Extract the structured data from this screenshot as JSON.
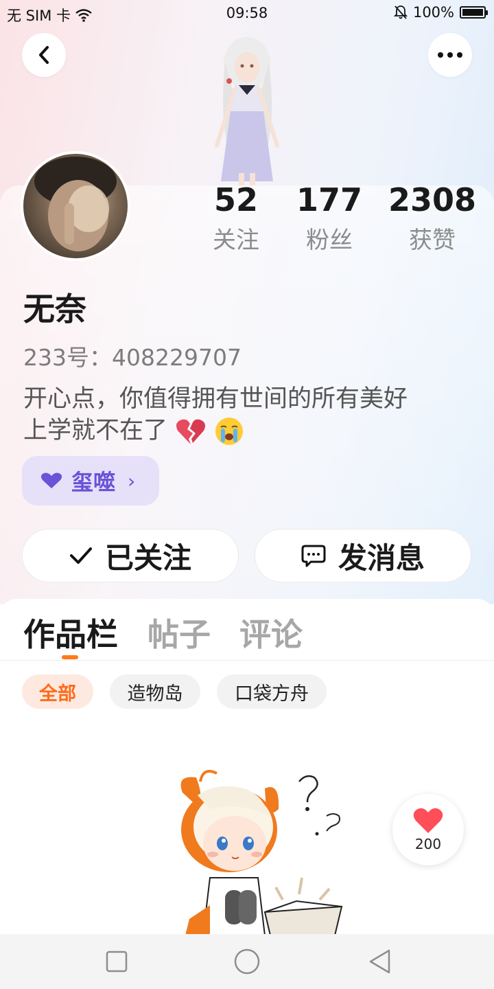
{
  "status_bar": {
    "carrier": "无 SIM 卡",
    "time": "09:58",
    "battery": "100%"
  },
  "profile": {
    "stats": [
      {
        "value": "52",
        "label": "关注"
      },
      {
        "value": "177",
        "label": "粉丝"
      },
      {
        "value": "2308",
        "label": "获赞"
      }
    ],
    "nickname": "无奈",
    "uid": "233号：408229707",
    "bio_line1": "开心点，你值得拥有世间的所有美好",
    "bio_line2": "上学就不在了",
    "tag_label": "玺噬",
    "follow_label": "已关注",
    "message_label": "发消息"
  },
  "tabs": [
    {
      "label": "作品栏"
    },
    {
      "label": "帖子"
    },
    {
      "label": "评论"
    }
  ],
  "filters": [
    {
      "label": "全部"
    },
    {
      "label": "造物岛"
    },
    {
      "label": "口袋方舟"
    }
  ],
  "like_count": "200",
  "colors": {
    "accent": "#ff7a1a",
    "tag_purple": "#6a53d6",
    "like_red": "#ff4d5a"
  },
  "icons": [
    "back-icon",
    "more-icon",
    "wifi-icon",
    "bell-off-icon",
    "check-icon",
    "message-icon",
    "heart-icon",
    "broken-heart-icon",
    "crying-face-icon"
  ]
}
